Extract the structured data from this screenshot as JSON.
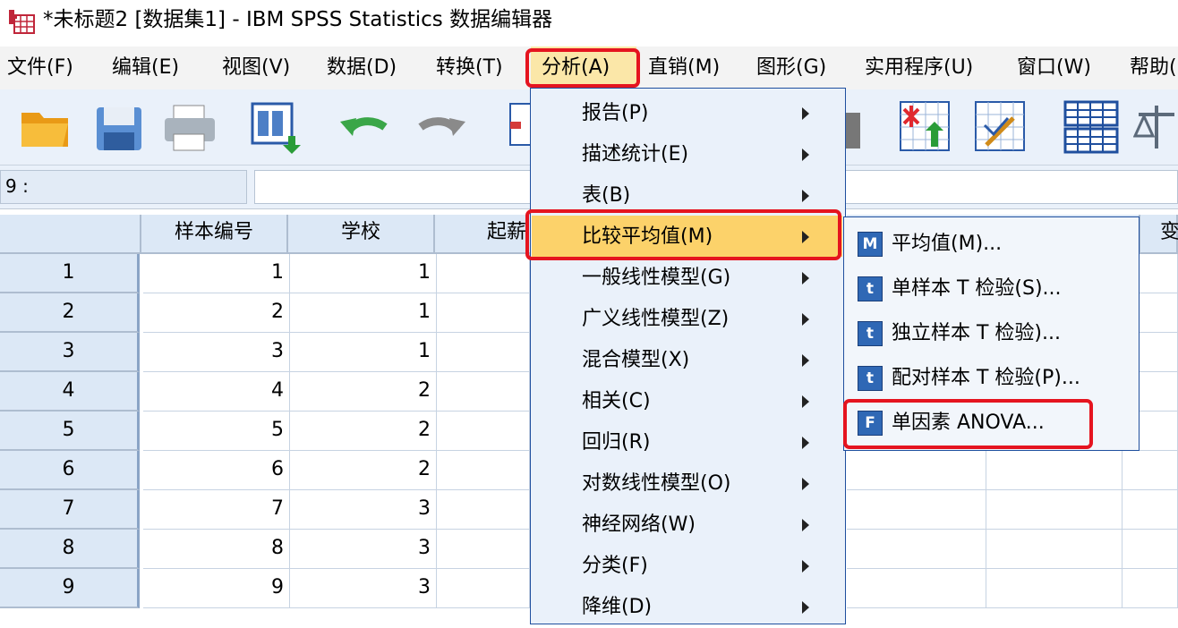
{
  "window": {
    "title": "*未标题2 [数据集1] - IBM SPSS Statistics 数据编辑器",
    "icon": "spss-data-editor-icon"
  },
  "menubar": {
    "items": [
      {
        "label": "文件(F)"
      },
      {
        "label": "编辑(E)"
      },
      {
        "label": "视图(V)"
      },
      {
        "label": "数据(D)"
      },
      {
        "label": "转换(T)"
      },
      {
        "label": "分析(A)",
        "active": true
      },
      {
        "label": "直销(M)"
      },
      {
        "label": "图形(G)"
      },
      {
        "label": "实用程序(U)"
      },
      {
        "label": "窗口(W)"
      },
      {
        "label": "帮助("
      }
    ]
  },
  "toolbar": {
    "icons": [
      "open-folder-icon",
      "save-icon",
      "print-icon",
      "recall-dialog-icon",
      "undo-icon",
      "redo-icon",
      "goto-case-icon",
      "weight-cases-icon",
      "insert-cases-icon",
      "select-cases-icon",
      "split-file-icon",
      "value-labels-icon"
    ]
  },
  "cell_bar": {
    "reference": "9 :",
    "value": ""
  },
  "grid": {
    "columns": [
      "样本编号",
      "学校",
      "起薪",
      "变"
    ],
    "rows": [
      {
        "n": "1",
        "id": "1",
        "school": "1"
      },
      {
        "n": "2",
        "id": "2",
        "school": "1"
      },
      {
        "n": "3",
        "id": "3",
        "school": "1"
      },
      {
        "n": "4",
        "id": "4",
        "school": "2"
      },
      {
        "n": "5",
        "id": "5",
        "school": "2"
      },
      {
        "n": "6",
        "id": "6",
        "school": "2"
      },
      {
        "n": "7",
        "id": "7",
        "school": "3"
      },
      {
        "n": "8",
        "id": "8",
        "school": "3"
      },
      {
        "n": "9",
        "id": "9",
        "school": "3"
      }
    ]
  },
  "analyze_menu": {
    "items": [
      {
        "label": "报告(P)"
      },
      {
        "label": "描述统计(E)"
      },
      {
        "label": "表(B)"
      },
      {
        "label": "比较平均值(M)",
        "highlighted": true
      },
      {
        "label": "一般线性模型(G)"
      },
      {
        "label": "广义线性模型(Z)"
      },
      {
        "label": "混合模型(X)"
      },
      {
        "label": "相关(C)"
      },
      {
        "label": "回归(R)"
      },
      {
        "label": "对数线性模型(O)"
      },
      {
        "label": "神经网络(W)"
      },
      {
        "label": "分类(F)"
      },
      {
        "label": "降维(D)"
      }
    ]
  },
  "compare_means_submenu": {
    "items": [
      {
        "label": "平均值(M)...",
        "icon_text": "M"
      },
      {
        "label": "单样本 T 检验(S)...",
        "icon_text": "t"
      },
      {
        "label": "独立样本 T 检验)...",
        "icon_text": "t"
      },
      {
        "label": "配对样本 T 检验(P)...",
        "icon_text": "t"
      },
      {
        "label": "单因素 ANOVA...",
        "icon_text": "F"
      }
    ]
  },
  "colors": {
    "highlight_box": "#e5141f",
    "menu_highlight": "#fcd26a",
    "header_bg": "#dce8f6"
  }
}
